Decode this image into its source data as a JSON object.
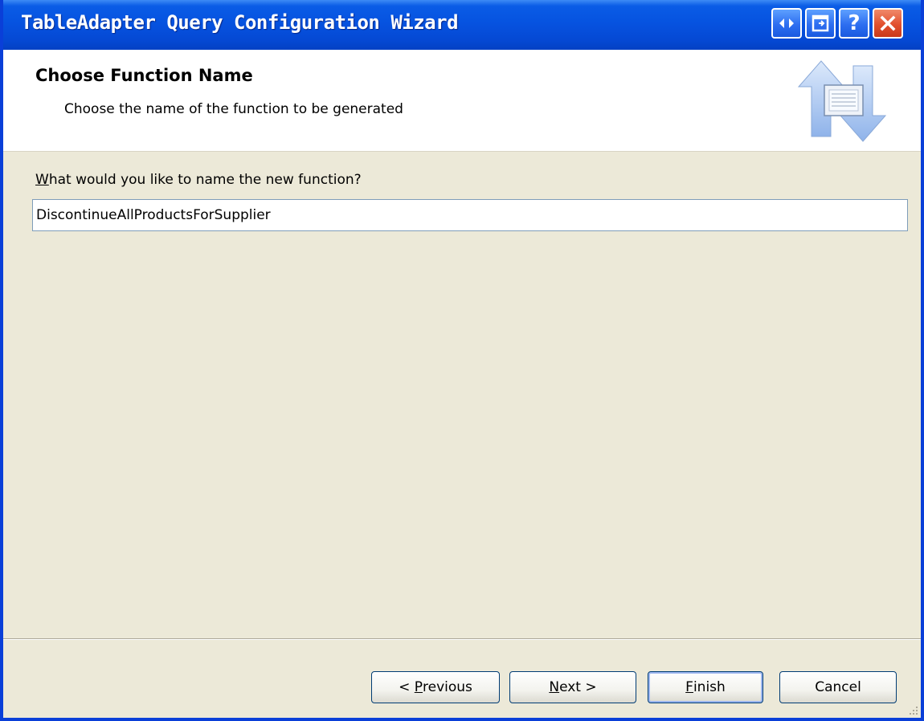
{
  "window": {
    "title": "TableAdapter Query Configuration Wizard",
    "controls": {
      "extra_icon": "arrows-left-right-icon",
      "restore_icon": "restore-window-icon",
      "help_label": "?",
      "close_icon": "close-icon"
    }
  },
  "header": {
    "title": "Choose Function Name",
    "subtitle": "Choose the name of the function to be generated",
    "art_icon": "wizard-data-transfer-icon"
  },
  "main": {
    "question_prefix": "W",
    "question_rest": "hat would you like to name the new function?",
    "function_name_value": "DiscontinueAllProductsForSupplier"
  },
  "buttons": {
    "previous_prefix": "< ",
    "previous_accel": "P",
    "previous_rest": "revious",
    "next_accel": "N",
    "next_rest": "ext >",
    "finish_accel": "F",
    "finish_rest": "inish",
    "cancel": "Cancel"
  },
  "colors": {
    "title_bar": "#0653e0",
    "dialog_bg": "#ece9d8",
    "header_bg": "#ffffff",
    "close_button": "#e2502e"
  }
}
